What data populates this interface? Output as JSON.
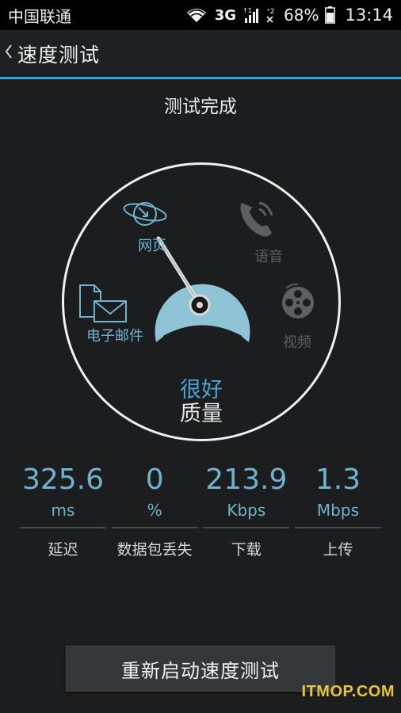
{
  "status_bar": {
    "carrier": "中国联通",
    "network": "3G",
    "sim_labels": [
      "1",
      "2"
    ],
    "battery_percent": "68%",
    "time": "13:14"
  },
  "header": {
    "back_icon": "chevron-left-icon",
    "title": "速度测试"
  },
  "test_status": "测试完成",
  "gauge": {
    "categories": {
      "web": {
        "label": "网页",
        "icon": "globe-icon",
        "active": true
      },
      "voice": {
        "label": "语音",
        "icon": "phone-icon",
        "active": false
      },
      "email": {
        "label": "电子邮件",
        "icon": "email-icon",
        "active": true
      },
      "video": {
        "label": "视频",
        "icon": "film-reel-icon",
        "active": false
      }
    },
    "rating": "很好",
    "rating_suffix": "质量",
    "colors": {
      "accent": "#6fb3cf",
      "gauge_fill": "#8ec4d6",
      "inactive": "#5d5f61"
    }
  },
  "stats": [
    {
      "value": "325.6",
      "unit": "ms",
      "label": "延迟"
    },
    {
      "value": "0",
      "unit": "%",
      "label": "数据包丢失"
    },
    {
      "value": "213.9",
      "unit": "Kbps",
      "label": "下载"
    },
    {
      "value": "1.3",
      "unit": "Mbps",
      "label": "上传"
    }
  ],
  "restart_button": "重新启动速度测试",
  "watermark": "ITMOP.COM"
}
